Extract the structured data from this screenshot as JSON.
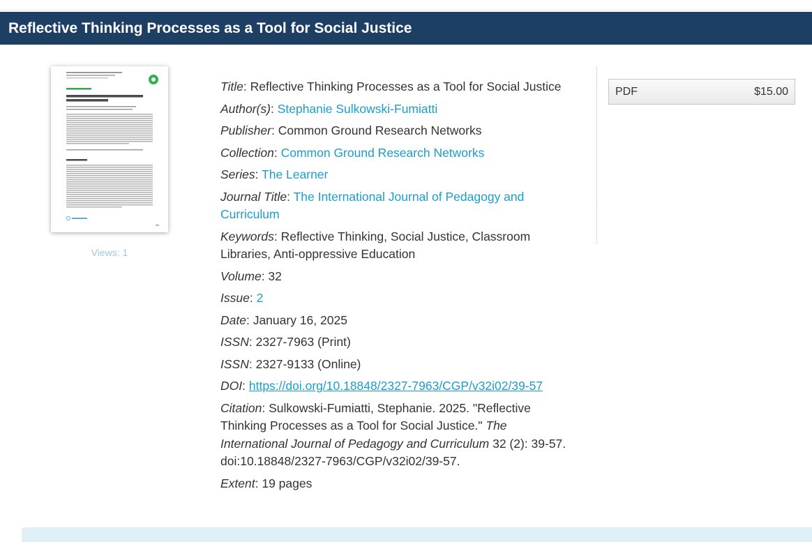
{
  "page": {
    "title": "Reflective Thinking Processes as a Tool for Social Justice"
  },
  "thumbnail": {
    "views_label": "Views: 1"
  },
  "metadata": {
    "title": {
      "label": "Title",
      "value": "Reflective Thinking Processes as a Tool for Social Justice"
    },
    "authors": {
      "label": "Author(s)",
      "value": "Stephanie Sulkowski-Fumiatti"
    },
    "publisher": {
      "label": "Publisher",
      "value": "Common Ground Research Networks"
    },
    "collection": {
      "label": "Collection",
      "value": "Common Ground Research Networks"
    },
    "series": {
      "label": "Series",
      "value": "The Learner"
    },
    "journal_title": {
      "label": "Journal Title",
      "value": "The International Journal of Pedagogy and Curriculum"
    },
    "keywords": {
      "label": "Keywords",
      "value": "Reflective Thinking, Social Justice, Classroom Libraries, Anti-oppressive Education"
    },
    "volume": {
      "label": "Volume",
      "value": "32"
    },
    "issue": {
      "label": "Issue",
      "value": "2"
    },
    "date": {
      "label": "Date",
      "value": "January 16, 2025"
    },
    "issn_print": {
      "label": "ISSN",
      "value": "2327-7963 (Print)"
    },
    "issn_online": {
      "label": "ISSN",
      "value": "2327-9133 (Online)"
    },
    "doi": {
      "label": "DOI",
      "value": "https://doi.org/10.18848/2327-7963/CGP/v32i02/39-57"
    },
    "citation": {
      "label": "Citation",
      "prefix": "Sulkowski-Fumiatti, Stephanie. 2025. \"Reflective Thinking Processes as a Tool for Social Justice.\" ",
      "journal": "The International Journal of Pedagogy and Curriculum",
      "suffix": " 32 (2): 39-57. doi:10.18848/2327-7963/CGP/v32i02/39-57."
    },
    "extent": {
      "label": "Extent",
      "value": "19 pages"
    }
  },
  "purchase": {
    "format": "PDF",
    "price": "$15.00"
  },
  "colors": {
    "header_bg": "#1d3f63",
    "link": "#1a9ec9",
    "badge_green": "#2db34a",
    "panel_bg": "#dff0f6"
  }
}
